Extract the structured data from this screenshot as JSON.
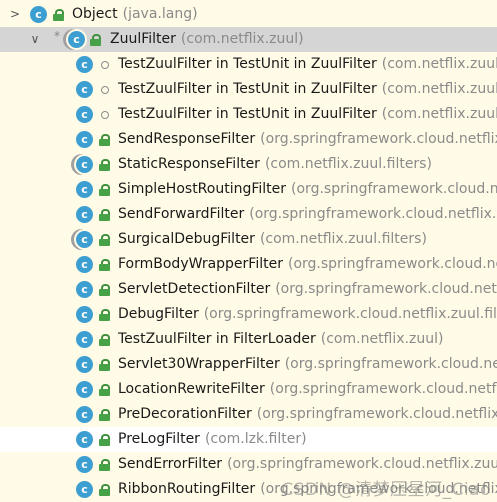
{
  "root": {
    "name": "Object",
    "package": "(java.lang)"
  },
  "selected": {
    "name": "ZuulFilter",
    "package": "(com.netflix.zuul)"
  },
  "children": [
    {
      "name": "TestZuulFilter in TestUnit in ZuulFilter",
      "package": "(com.netflix.zuul)",
      "access": "package"
    },
    {
      "name": "TestZuulFilter in TestUnit in ZuulFilter",
      "package": "(com.netflix.zuul)",
      "access": "package"
    },
    {
      "name": "TestZuulFilter in TestUnit in ZuulFilter",
      "package": "(com.netflix.zuul)",
      "access": "package"
    },
    {
      "name": "SendResponseFilter",
      "package": "(org.springframework.cloud.netflix.zuul.filters.post)",
      "access": "public"
    },
    {
      "name": "StaticResponseFilter",
      "package": "(com.netflix.zuul.filters)",
      "access": "public",
      "abstract": true
    },
    {
      "name": "SimpleHostRoutingFilter",
      "package": "(org.springframework.cloud.netflix.zuul.filters.route)",
      "access": "public"
    },
    {
      "name": "SendForwardFilter",
      "package": "(org.springframework.cloud.netflix.zuul.filters.route)",
      "access": "public"
    },
    {
      "name": "SurgicalDebugFilter",
      "package": "(com.netflix.zuul.filters)",
      "access": "public",
      "abstract": true
    },
    {
      "name": "FormBodyWrapperFilter",
      "package": "(org.springframework.cloud.netflix.zuul.filters.pre)",
      "access": "public"
    },
    {
      "name": "ServletDetectionFilter",
      "package": "(org.springframework.cloud.netflix.zuul.filters.pre)",
      "access": "public"
    },
    {
      "name": "DebugFilter",
      "package": "(org.springframework.cloud.netflix.zuul.filters.pre)",
      "access": "public"
    },
    {
      "name": "TestZuulFilter in FilterLoader",
      "package": "(com.netflix.zuul)",
      "access": "public"
    },
    {
      "name": "Servlet30WrapperFilter",
      "package": "(org.springframework.cloud.netflix.zuul.filters.pre)",
      "access": "public"
    },
    {
      "name": "LocationRewriteFilter",
      "package": "(org.springframework.cloud.netflix.zuul.filters.post)",
      "access": "public"
    },
    {
      "name": "PreDecorationFilter",
      "package": "(org.springframework.cloud.netflix.zuul.filters.pre)",
      "access": "public"
    },
    {
      "name": "PreLogFilter",
      "package": "(com.lzk.filter)",
      "access": "public",
      "highlighted": true
    },
    {
      "name": "SendErrorFilter",
      "package": "(org.springframework.cloud.netflix.zuul.filters.post)",
      "access": "public"
    },
    {
      "name": "RibbonRoutingFilter",
      "package": "(org.springframework.cloud.netflix.zuul.filters.route)",
      "access": "public"
    }
  ],
  "icons": {
    "class_letter": "c",
    "expanded_arrow": "chevron-down-icon",
    "collapsed_arrow": "chevron-right-icon"
  },
  "colors": {
    "background": "#fffbe6",
    "selected_row": "#d5d5d5",
    "class_icon": "#3d9fd1",
    "lock_icon": "#47a247",
    "package_text": "#8a8a8a"
  },
  "watermark": "CSDN @清梦压星河_Ciao"
}
